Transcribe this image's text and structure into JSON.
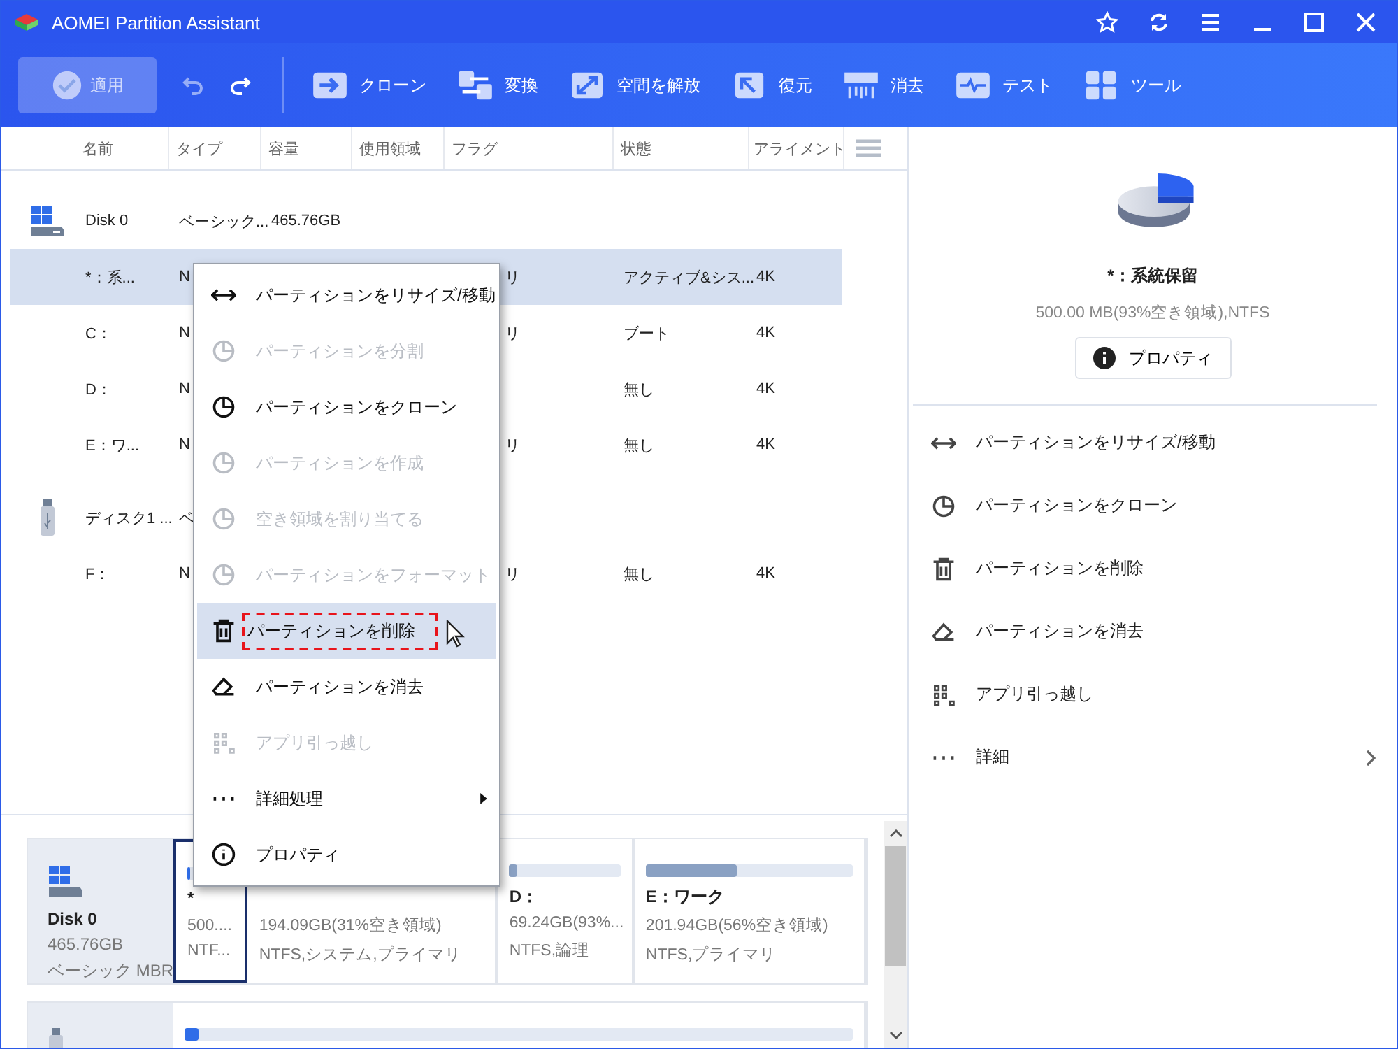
{
  "window": {
    "title": "AOMEI Partition Assistant"
  },
  "toolbar": {
    "apply": {
      "label": "適用",
      "disabled": true
    },
    "undo": {
      "disabled": true
    },
    "redo": {
      "disabled": false
    },
    "tools": [
      {
        "label": "クローン"
      },
      {
        "label": "変換"
      },
      {
        "label": "空間を解放"
      },
      {
        "label": "復元"
      },
      {
        "label": "消去"
      },
      {
        "label": "テスト"
      },
      {
        "label": "ツール"
      }
    ]
  },
  "table": {
    "columns": [
      "名前",
      "タイプ",
      "容量",
      "使用領域",
      "フラグ",
      "状態",
      "アライメント"
    ],
    "rows": [
      {
        "kind": "hdd",
        "name": "Disk 0",
        "type": "ベーシック...",
        "capacity": "465.76GB",
        "selected": false
      },
      {
        "kind": "partition",
        "name": "*：系...",
        "type": "N",
        "flag": "リ",
        "status": "アクティブ&シス...",
        "align": "4K",
        "selected": true
      },
      {
        "kind": "partition",
        "name": "C：",
        "type": "N",
        "flag": "リ",
        "status": "ブート",
        "align": "4K",
        "selected": false
      },
      {
        "kind": "partition",
        "name": "D：",
        "type": "N",
        "status": "無し",
        "align": "4K",
        "selected": false
      },
      {
        "kind": "partition",
        "name": "E：ワ...",
        "type": "N",
        "flag": "リ",
        "status": "無し",
        "align": "4K",
        "selected": false
      },
      {
        "kind": "usb",
        "name": "ディスク1 ...",
        "type": "ベ",
        "selected": false
      },
      {
        "kind": "partition",
        "name": "F：",
        "type": "N",
        "flag": "リ",
        "status": "無し",
        "align": "4K",
        "selected": false
      }
    ]
  },
  "context_menu": [
    {
      "label": "パーティションをリサイズ/移動",
      "disabled": false,
      "selected": false
    },
    {
      "label": "パーティションを分割",
      "disabled": true,
      "selected": false
    },
    {
      "label": "パーティションをクローン",
      "disabled": false,
      "selected": false
    },
    {
      "label": "パーティションを作成",
      "disabled": true,
      "selected": false
    },
    {
      "label": "空き領域を割り当てる",
      "disabled": true,
      "selected": false
    },
    {
      "label": "パーティションをフォーマット",
      "disabled": true,
      "selected": false
    },
    {
      "label": "パーティションを削除",
      "disabled": false,
      "selected": true,
      "annotated": true
    },
    {
      "label": "パーティションを消去",
      "disabled": false,
      "selected": false
    },
    {
      "label": "アプリ引っ越し",
      "disabled": true,
      "selected": false
    },
    {
      "label": "詳細処理",
      "disabled": false,
      "selected": false,
      "submenu": true
    },
    {
      "label": "プロパティ",
      "disabled": false,
      "selected": false
    }
  ],
  "disk_map": [
    {
      "name": "Disk 0",
      "size": "465.76GB",
      "style": "ベーシック MBR",
      "partitions": [
        {
          "title": "*",
          "size": "500....",
          "info": "NTF...",
          "level": 0.07,
          "selected": true
        },
        {
          "size": "194.09GB(31%空き領域)",
          "info": "NTFS,システム,プライマリ",
          "selected": false
        },
        {
          "title": "D：",
          "size": "69.24GB(93%...",
          "info": "NTFS,論理",
          "level": 0.07,
          "selected": false
        },
        {
          "title": "E：ワーク",
          "size": "201.94GB(56%空き領域)",
          "info": "NTFS,プライマリ",
          "level": 0.44,
          "selected": false
        }
      ]
    },
    {
      "partitions": [
        {
          "level": 0.02,
          "selected": false
        }
      ]
    }
  ],
  "details": {
    "title": "*：系統保留",
    "info": "500.00 MB(93%空き領域),NTFS",
    "button": "プロパティ",
    "actions": [
      {
        "label": "パーティションをリサイズ/移動"
      },
      {
        "label": "パーティションをクローン"
      },
      {
        "label": "パーティションを削除"
      },
      {
        "label": "パーティションを消去"
      },
      {
        "label": "アプリ引っ越し"
      },
      {
        "label": "詳細",
        "submenu": true
      }
    ]
  }
}
